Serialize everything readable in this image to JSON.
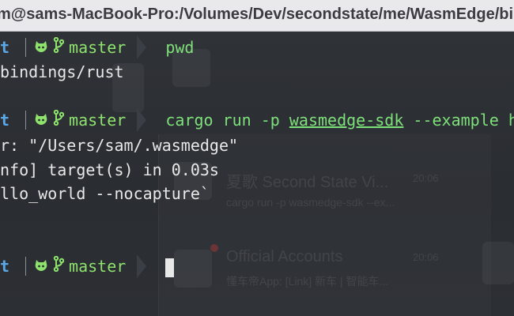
{
  "window": {
    "title": "m@sams-MacBook-Pro:/Volumes/Dev/secondstate/me/WasmEdge/bin"
  },
  "prompt": {
    "dir_fragment": "t",
    "branch": "master"
  },
  "terminal": {
    "cmd1": "pwd",
    "out1": "bindings/rust",
    "cmd2_prefix": "cargo run -p ",
    "cmd2_underlined": "wasmedge-sdk",
    "cmd2_suffix": " --example hel",
    "out2": "r: \"/Users/sam/.wasmedge\"",
    "out3": "nfo] target(s) in 0.03s",
    "out4": "llo_world --nocapture`"
  },
  "background_app": {
    "chat1_name": "夏歌 Second State Vi...",
    "chat1_time": "20:06",
    "chat1_preview": "cargo run -p wasmedge-sdk --ex...",
    "chat2_name": "Official Accounts",
    "chat2_time": "20:06",
    "chat2_preview": "懂车帝App: [Link] 新车 | 智能车..."
  },
  "colors": {
    "dir": "#5aa7e6",
    "git": "#8ee36d",
    "command": "#7ee07a",
    "background": "#2b2e33"
  },
  "icons": {
    "git_repo": "github-icon",
    "branch": "git-branch-icon"
  }
}
